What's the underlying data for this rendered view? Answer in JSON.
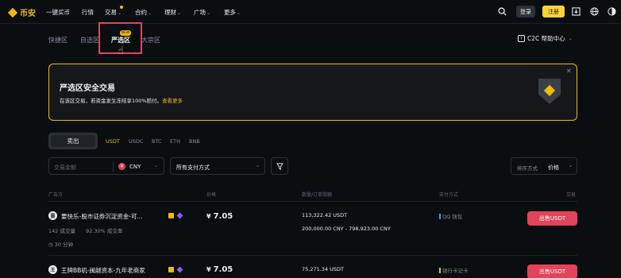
{
  "brand": {
    "name": "币安",
    "color": "#f0b90b"
  },
  "nav": {
    "items": [
      {
        "label": "一键买币",
        "caret": false
      },
      {
        "label": "行情",
        "caret": false
      },
      {
        "label": "交易",
        "caret": true
      },
      {
        "label": "合约",
        "caret": true
      },
      {
        "label": "理财",
        "caret": true
      },
      {
        "label": "广场",
        "caret": true
      },
      {
        "label": "更多",
        "caret": true
      }
    ],
    "login_label": "登录",
    "register_label": "注册",
    "icons": [
      "search-icon",
      "download-icon",
      "globe-icon",
      "theme-toggle-icon"
    ]
  },
  "zones": {
    "tabs": [
      "快捷区",
      "自选区",
      "严选区",
      "大宗区"
    ],
    "active": "严选区",
    "badge": "NEW"
  },
  "help": {
    "label": "C2C 帮助中心"
  },
  "banner": {
    "title": "严选区安全交易",
    "text": "在该区交易，若资金发生冻结享100%赔付。",
    "link": "查看更多"
  },
  "trade": {
    "type_label": "卖出",
    "assets": [
      "USDT",
      "USDC",
      "BTC",
      "ETH",
      "BNB"
    ],
    "active_asset": "USDT"
  },
  "filters": {
    "amount_placeholder": "交易金额",
    "currency": "CNY",
    "payment": "所有支付方式",
    "sort_label": "排序方式",
    "sort_value": "价格"
  },
  "table": {
    "headers": [
      "广告方",
      "价格",
      "数量/订单限额",
      "支付方式",
      "交易"
    ],
    "rows": [
      {
        "avatar": "要",
        "name": "要快乐-股市证券沉淀资金-可...",
        "orders": "142 成交量",
        "rate": "92.30% 成交率",
        "time": "30 分钟",
        "price": "7.05",
        "currency_symbol": "¥",
        "available": "113,322.42 USDT",
        "limit": "200,000.00 CNY - 798,923.00 CNY",
        "payment": "QQ 钱包",
        "payment_color": "#2f9bf7",
        "action": "出售USDT"
      },
      {
        "avatar": "王",
        "name": "王牌BB机-闽越资本-九年老商家",
        "price": "7.05",
        "currency_symbol": "¥",
        "available": "75,271.34 USDT",
        "payment": "银行卡记卡",
        "payment_color": "#f0b90b",
        "action": "出售USDT"
      }
    ]
  }
}
